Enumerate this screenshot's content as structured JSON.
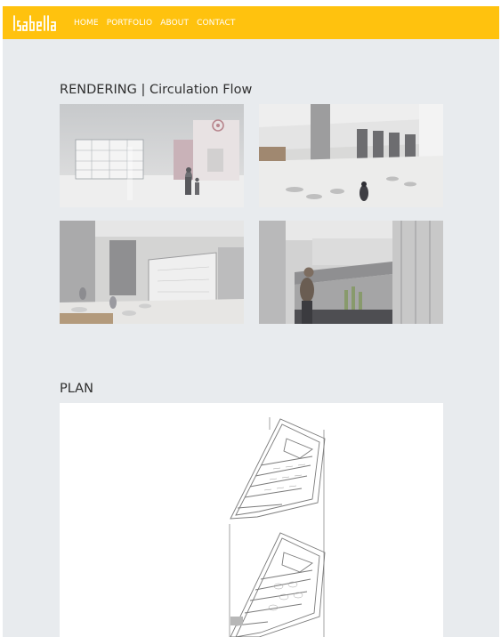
{
  "header": {
    "logo_text": "Isabella",
    "nav": [
      "HOME",
      "PORTFOLIO",
      "ABOUT",
      "CONTACT"
    ],
    "background_color": "#ffc20e"
  },
  "sections": {
    "rendering": {
      "title": "RENDERING | Circulation Flow"
    },
    "plan": {
      "title": "PLAN"
    }
  },
  "colors": {
    "page_background": "#e8ebee",
    "plan_background": "#ffffff",
    "text": "#2f2f2f"
  }
}
